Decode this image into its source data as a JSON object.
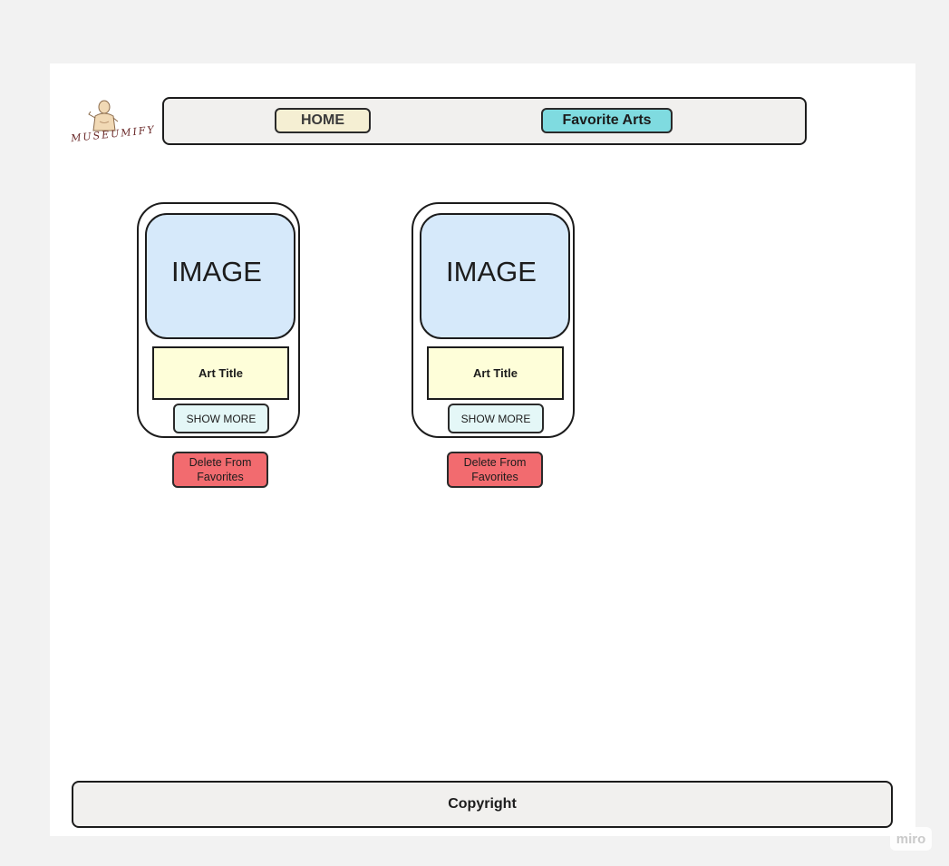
{
  "logo": {
    "text": "MUSEUMIFY"
  },
  "nav": {
    "home_label": "HOME",
    "favorites_label": "Favorite Arts"
  },
  "cards": [
    {
      "image_label": "IMAGE",
      "title": "Art Title",
      "more_label": "SHOW MORE",
      "delete_label": "Delete From Favorites"
    },
    {
      "image_label": "IMAGE",
      "title": "Art Title",
      "more_label": "SHOW MORE",
      "delete_label": "Delete From Favorites"
    }
  ],
  "footer": {
    "text": "Copyright"
  },
  "watermark": {
    "text": "miro"
  },
  "colors": {
    "background": "#f2f2f2",
    "board": "#ffffff",
    "home_button": "#f5efd3",
    "favorites_button": "#7fdbe0",
    "image_box": "#d6e9fa",
    "title_box": "#fefed9",
    "show_more": "#e4f7f7",
    "delete_button": "#f26b6f"
  }
}
